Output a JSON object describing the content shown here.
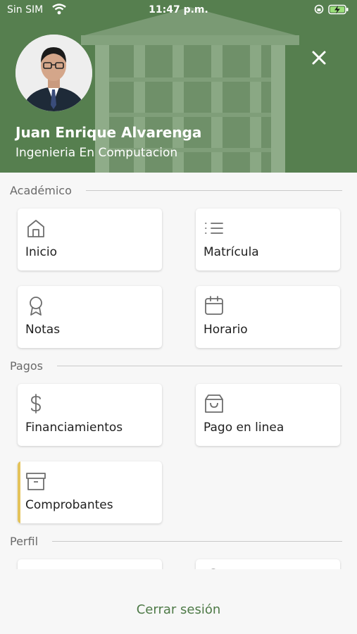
{
  "status_bar": {
    "carrier": "Sin SIM",
    "time": "11:47 p.m."
  },
  "profile": {
    "name": "Juan Enrique Alvarenga",
    "career": "Ingenieria En Computacion"
  },
  "sections": {
    "academico": {
      "title": "Académico",
      "items": [
        {
          "label": "Inicio",
          "icon": "home-icon"
        },
        {
          "label": "Matrícula",
          "icon": "list-icon"
        },
        {
          "label": "Notas",
          "icon": "award-icon"
        },
        {
          "label": "Horario",
          "icon": "calendar-icon"
        }
      ]
    },
    "pagos": {
      "title": "Pagos",
      "items": [
        {
          "label": "Financiamientos",
          "icon": "dollar-icon"
        },
        {
          "label": "Pago en linea",
          "icon": "shopping-bag-icon"
        },
        {
          "label": "Comprobantes",
          "icon": "archive-icon",
          "active": true
        }
      ]
    },
    "perfil": {
      "title": "Perfil"
    }
  },
  "logout_label": "Cerrar sesión",
  "colors": {
    "header": "#567f4f",
    "accent": "#4e7a47",
    "active_marker": "#e4c35a"
  }
}
